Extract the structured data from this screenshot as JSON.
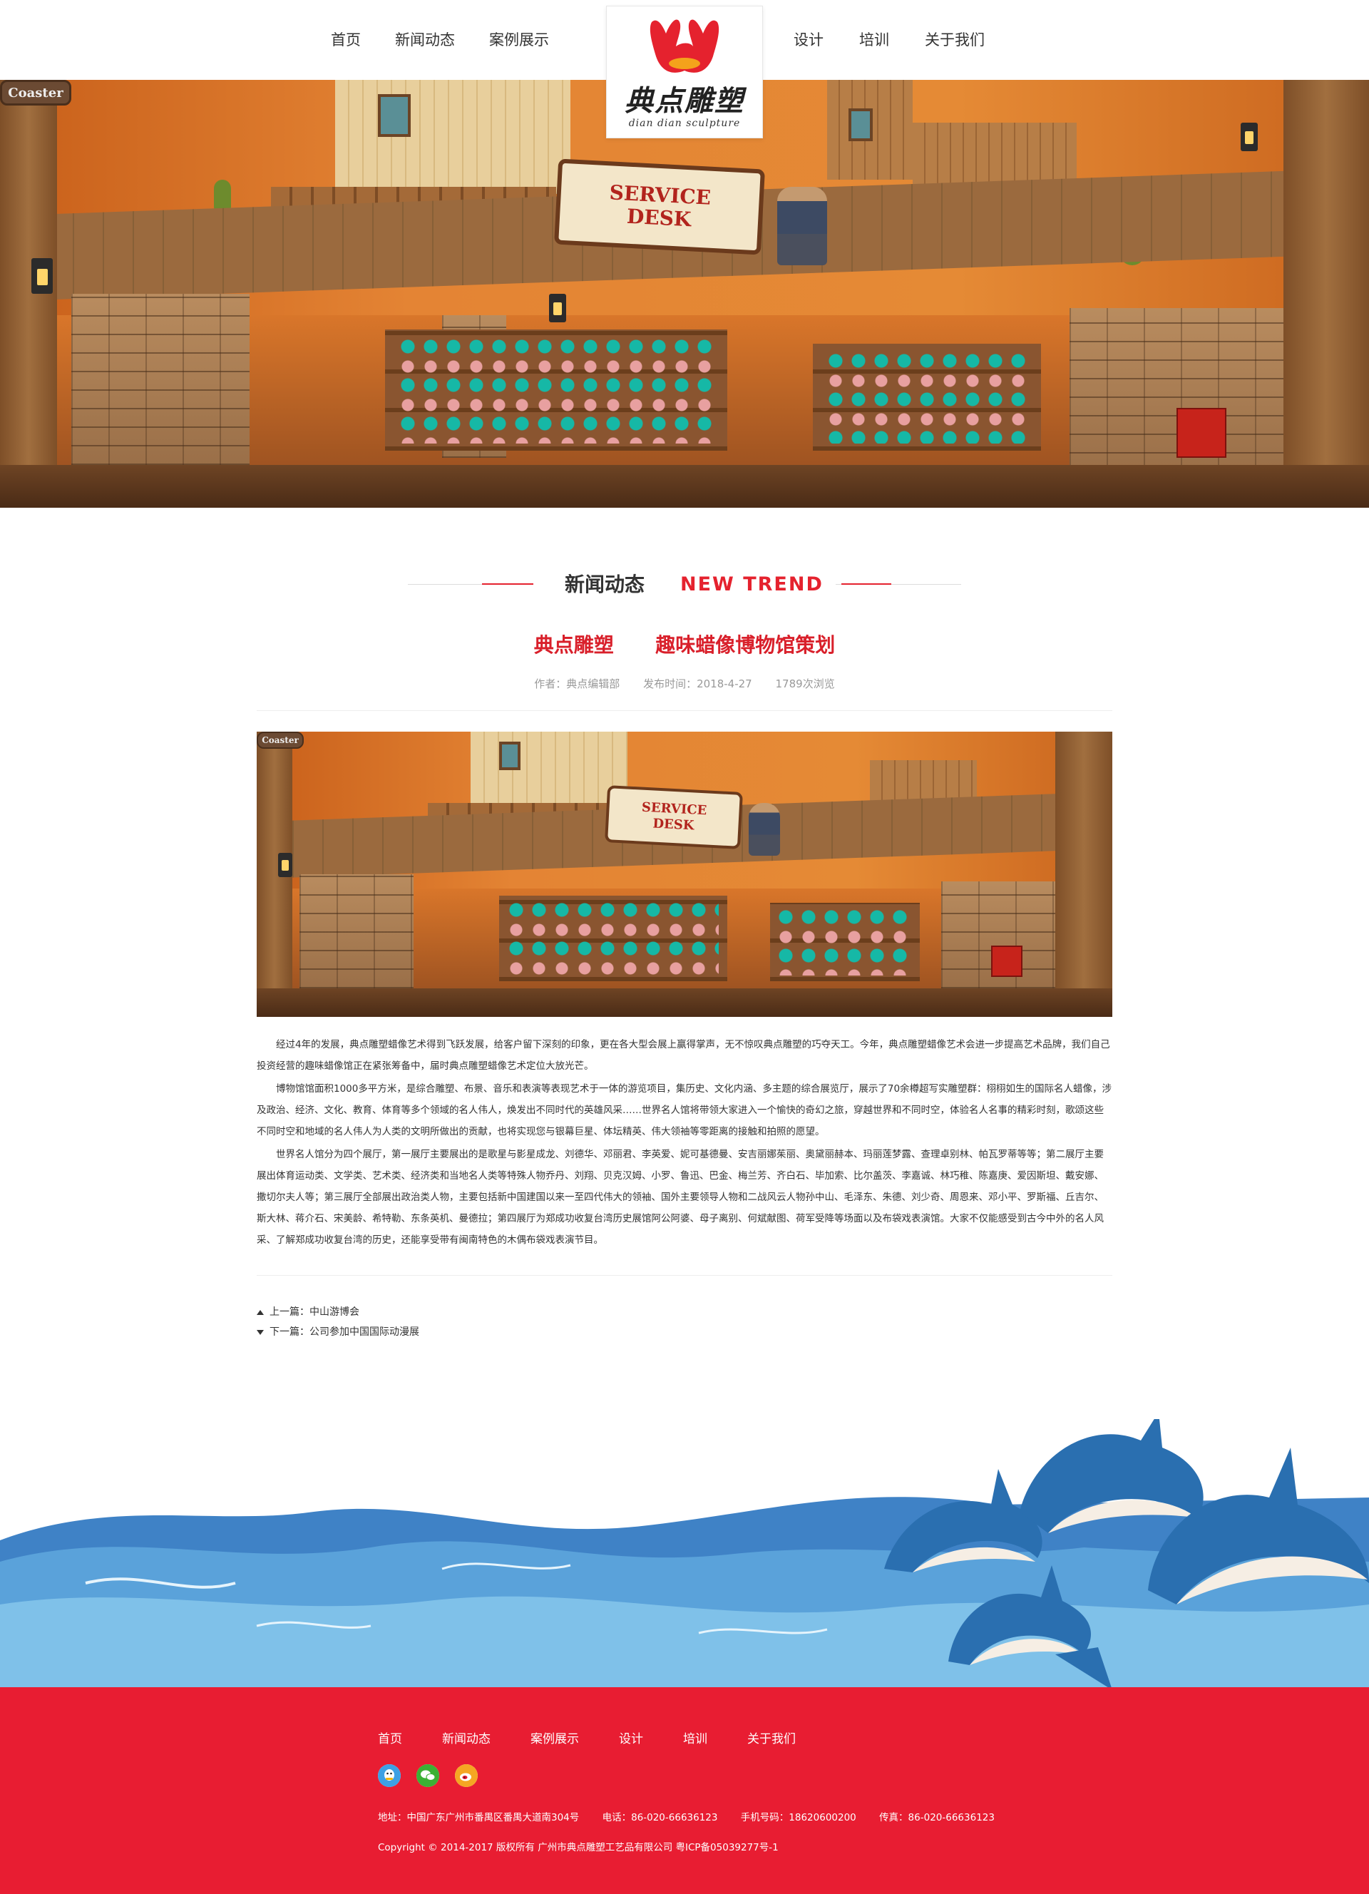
{
  "header": {
    "nav_left": [
      "首页",
      "新闻动态",
      "案例展示"
    ],
    "nav_right": [
      "设计",
      "培训",
      "关于我们"
    ],
    "logo_cn": "典点雕塑",
    "logo_en": "dian dian sculpture"
  },
  "banner": {
    "left_sign": "Coaster",
    "desk_sign_line1": "SERVICE",
    "desk_sign_line2": "DESK"
  },
  "section": {
    "title_cn": "新闻动态",
    "title_en": "NEW TREND"
  },
  "article": {
    "title": "典点雕塑      趣味蜡像博物馆策划",
    "author": "作者：典点编辑部",
    "date": "发布时间：2018-4-27",
    "views": "1789次浏览",
    "paragraphs": [
      "经过4年的发展，典点雕塑蜡像艺术得到飞跃发展，给客户留下深刻的印象，更在各大型会展上赢得掌声，无不惊叹典点雕塑的巧夺天工。今年，典点雕塑蜡像艺术会进一步提高艺术品牌，我们自己投资经营的趣味蜡像馆正在紧张筹备中，届时典点雕塑蜡像艺术定位大放光芒。",
      "博物馆馆面积1000多平方米，是综合雕塑、布景、音乐和表演等表现艺术于一体的游览项目，集历史、文化内涵、多主题的综合展览厅，展示了70余樽超写实雕塑群：栩栩如生的国际名人蜡像，涉及政治、经济、文化、教育、体育等多个领域的名人伟人，焕发出不同时代的英雄风采……世界名人馆将带领大家进入一个愉快的奇幻之旅，穿越世界和不同时空，体验名人名事的精彩时刻，歌颂这些不同时空和地域的名人伟人为人类的文明所做出的贡献，也将实现您与银幕巨星、体坛精英、伟大领袖等零距离的接触和拍照的愿望。",
      "世界名人馆分为四个展厅，第一展厅主要展出的是歌星与影星成龙、刘德华、邓丽君、李英爱、妮可基德曼、安吉丽娜茱丽、奥黛丽赫本、玛丽莲梦露、查理卓别林、帕瓦罗蒂等等；第二展厅主要展出体育运动类、文学类、艺术类、经济类和当地名人类等特殊人物乔丹、刘翔、贝克汉姆、小罗、鲁迅、巴金、梅兰芳、齐白石、毕加索、比尔盖茨、李嘉诚、林巧稚、陈嘉庚、爱因斯坦、戴安娜、撒切尔夫人等；第三展厅全部展出政治类人物，主要包括新中国建国以来一至四代伟大的领袖、国外主要领导人物和二战风云人物孙中山、毛泽东、朱德、刘少奇、周恩来、邓小平、罗斯福、丘吉尔、斯大林、蒋介石、宋美龄、希特勒、东条英机、曼德拉；第四展厅为郑成功收复台湾历史展馆阿公阿婆、母子离别、何斌献图、荷军受降等场面以及布袋戏表演馆。大家不仅能感受到古今中外的名人风采、了解郑成功收复台湾的历史，还能享受带有闽南特色的木偶布袋戏表演节目。"
    ],
    "prev": "上一篇：中山游博会",
    "next": "下一篇：公司参加中国国际动漫展"
  },
  "footer": {
    "nav": [
      "首页",
      "新闻动态",
      "案例展示",
      "设计",
      "培训",
      "关于我们"
    ],
    "social_icons": [
      "qq-icon",
      "wechat-icon",
      "weibo-icon"
    ],
    "address": "地址：中国广东广州市番禺区番禺大道南304号",
    "phone": "电话：86-020-66636123",
    "mobile": "手机号码：18620600200",
    "fax": "传真：86-020-66636123",
    "copyright": "Copyright © 2014-2017 版权所有 广州市典点雕塑工艺品有限公司   粤ICP备05039277号-1"
  },
  "colors": {
    "brand_red": "#e81d32",
    "title_red": "#d9202b",
    "wave_blue": "#4a90cf",
    "dolphin_blue": "#2a6fb0"
  }
}
